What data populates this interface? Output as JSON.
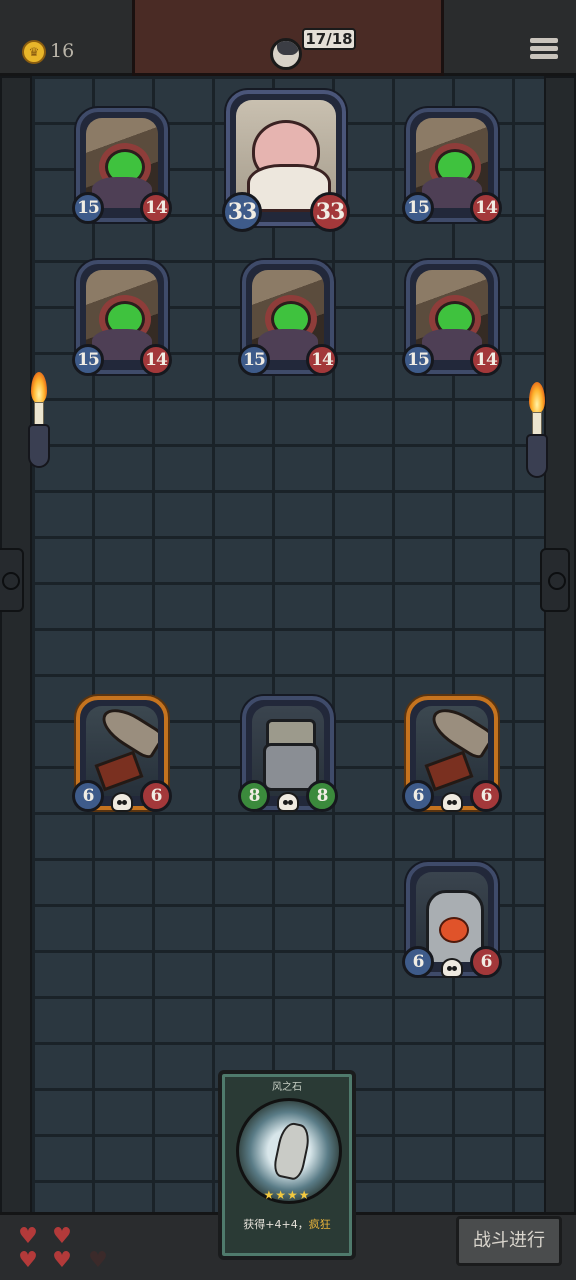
{
  "hud": {
    "gold": "16",
    "lives": "17/18"
  },
  "enemies": [
    {
      "name": "goblin",
      "attack": "15",
      "health": "14"
    },
    {
      "name": "pig-king",
      "attack": "33",
      "health": "33"
    },
    {
      "name": "goblin",
      "attack": "15",
      "health": "14"
    },
    {
      "name": "goblin",
      "attack": "15",
      "health": "14"
    },
    {
      "name": "goblin",
      "attack": "15",
      "health": "14"
    },
    {
      "name": "goblin",
      "attack": "15",
      "health": "14"
    }
  ],
  "allies": [
    {
      "name": "rocket-cart",
      "attack": "6",
      "health": "6"
    },
    {
      "name": "robot",
      "attack": "8",
      "health": "8"
    },
    {
      "name": "rocket-cart",
      "attack": "6",
      "health": "6"
    },
    {
      "name": "heart-golem",
      "attack": "6",
      "health": "6"
    }
  ],
  "hand_card": {
    "title": "风之石",
    "stars": "★★★★",
    "desc_prefix": "获得+4+4，",
    "desc_keyword": "疯狂"
  },
  "hearts": {
    "filled": 4,
    "total": 5
  },
  "fight_button": "战斗进行",
  "colors": {
    "attack": "#3e5b8a",
    "health": "#a3383a",
    "buff": "#3b8a3c",
    "gold_border": "#c5731f"
  }
}
